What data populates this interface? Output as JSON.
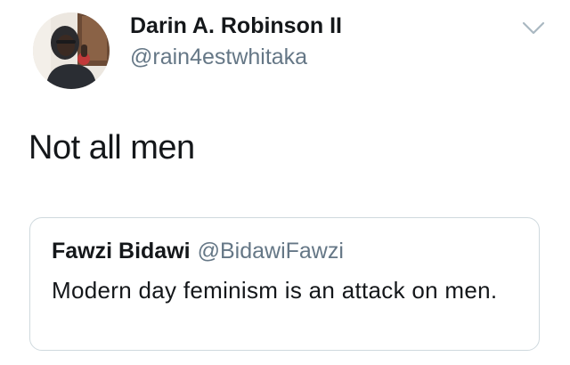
{
  "tweet": {
    "author_name": "Darin A. Robinson II",
    "author_handle": "@rain4estwhitaka",
    "text": "Not all men",
    "menu_icon": "chevron-down-icon"
  },
  "quoted_tweet": {
    "author_name": "Fawzi Bidawi",
    "author_handle": "@BidawiFawzi",
    "text": "Modern day feminism is an attack on men."
  },
  "colors": {
    "primary_text": "#14171a",
    "secondary_text": "#657786",
    "border": "#cfd9de",
    "background": "#ffffff"
  }
}
